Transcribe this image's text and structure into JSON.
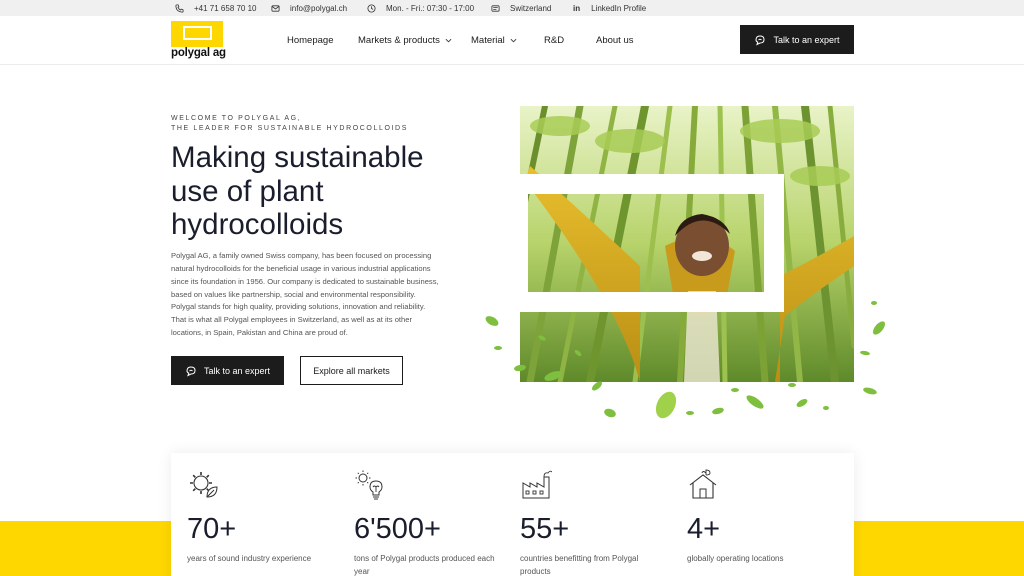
{
  "topbar": {
    "phone": "+41 71 658 70 10",
    "email": "info@polygal.ch",
    "hours": "Mon. - Fri.: 07:30 - 17:00",
    "country": "Switzerland",
    "linkedin_glyph": "in",
    "linkedin": "LinkedIn Profile"
  },
  "header": {
    "logo_text": "polygal ag",
    "nav": {
      "homepage": "Homepage",
      "markets": "Markets & products",
      "material": "Material",
      "rd": "R&D",
      "about": "About us"
    },
    "cta": "Talk to an expert"
  },
  "hero": {
    "eyebrow_line1": "WELCOME TO POLYGAL AG,",
    "eyebrow_line2": "THE LEADER FOR SUSTAINABLE HYDROCOLLOIDS",
    "title_line1": "Making sustainable",
    "title_line2": "use of plant",
    "title_line3": "hydrocolloids",
    "body_lines": [
      "Polygal AG, a family owned Swiss company, has been focused on processing",
      "natural hydrocolloids for the beneficial usage in various industrial applications",
      "since its foundation in 1956. Our company is dedicated to sustainable business,",
      "based on values like partnership, social and environmental responsibility.",
      "Polygal stands for high quality, providing solutions, innovation and reliability.",
      "That is what all Polygal employees in Switzerland, as well as at its other",
      "locations, in Spain, Pakistan and China are proud of."
    ],
    "primary_button": "Talk to an expert",
    "secondary_button": "Explore all markets"
  },
  "stats": [
    {
      "value": "70+",
      "label": "years of sound industry experience",
      "icon": "gear-leaf-icon"
    },
    {
      "value": "6'500+",
      "label": "tons of Polygal products produced each year",
      "icon": "sun-bulb-icon"
    },
    {
      "value": "55+",
      "label": "countries benefitting from Polygal products",
      "icon": "factory-icon"
    },
    {
      "value": "4+",
      "label": "globally operating locations",
      "icon": "house-plant-icon"
    }
  ],
  "colors": {
    "brand_yellow": "#ffd700",
    "dark": "#1c1c1c"
  }
}
